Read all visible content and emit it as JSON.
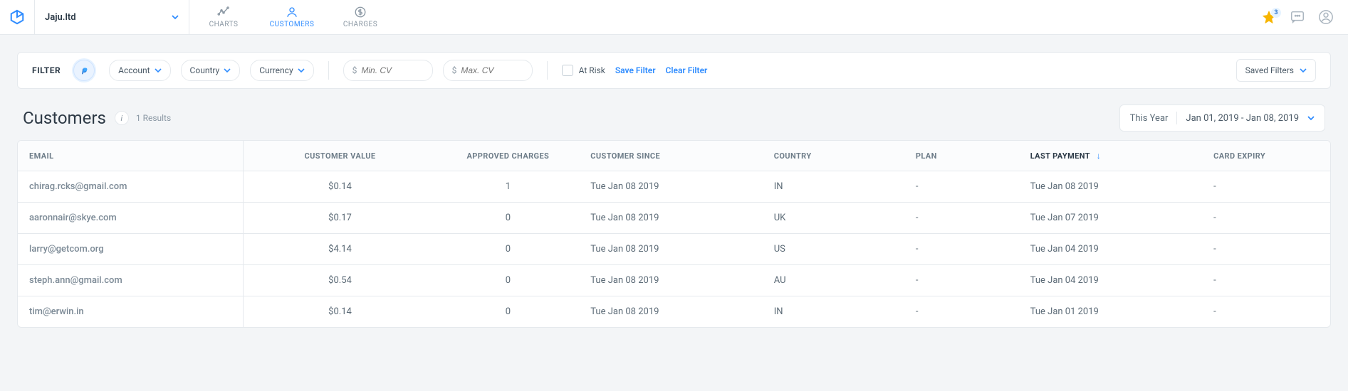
{
  "header": {
    "account_name": "Jaju.ltd",
    "nav": {
      "charts": "CHARTS",
      "customers": "CUSTOMERS",
      "charges": "CHARGES"
    },
    "notifications_count": "3"
  },
  "filter": {
    "label": "FILTER",
    "dropdowns": {
      "account": "Account",
      "country": "Country",
      "currency": "Currency"
    },
    "currency_symbol": "$",
    "min_cv_placeholder": "Min. CV",
    "max_cv_placeholder": "Max. CV",
    "at_risk": "At Risk",
    "save_filter": "Save Filter",
    "clear_filter": "Clear Filter",
    "saved_filters": "Saved Filters"
  },
  "page": {
    "title": "Customers",
    "results_text": "1 Results",
    "range_label": "This Year",
    "range_value": "Jan 01, 2019 - Jan 08, 2019"
  },
  "columns": {
    "email": "EMAIL",
    "customer_value": "CUSTOMER VALUE",
    "approved_charges": "APPROVED CHARGES",
    "customer_since": "CUSTOMER SINCE",
    "country": "COUNTRY",
    "plan": "PLAN",
    "last_payment": "LAST PAYMENT",
    "card_expiry": "CARD EXPIRY"
  },
  "rows": [
    {
      "email": "chirag.rcks@gmail.com",
      "customer_value": "$0.14",
      "approved_charges": "1",
      "customer_since": "Tue Jan 08 2019",
      "country": "IN",
      "plan": "-",
      "last_payment": "Tue Jan 08 2019",
      "card_expiry": "-"
    },
    {
      "email": "aaronnair@skye.com",
      "customer_value": "$0.17",
      "approved_charges": "0",
      "customer_since": "Tue Jan 08 2019",
      "country": "UK",
      "plan": "-",
      "last_payment": "Tue Jan 07 2019",
      "card_expiry": "-"
    },
    {
      "email": "larry@getcom.org",
      "customer_value": "$4.14",
      "approved_charges": "0",
      "customer_since": "Tue Jan 08 2019",
      "country": "US",
      "plan": "-",
      "last_payment": "Tue Jan 04 2019",
      "card_expiry": "-"
    },
    {
      "email": "steph.ann@gmail.com",
      "customer_value": "$0.54",
      "approved_charges": "0",
      "customer_since": "Tue Jan 08 2019",
      "country": "AU",
      "plan": "-",
      "last_payment": "Tue Jan 04 2019",
      "card_expiry": "-"
    },
    {
      "email": "tim@erwin.in",
      "customer_value": "$0.14",
      "approved_charges": "0",
      "customer_since": "Tue Jan 08 2019",
      "country": "IN",
      "plan": "-",
      "last_payment": "Tue Jan 01 2019",
      "card_expiry": "-"
    }
  ]
}
